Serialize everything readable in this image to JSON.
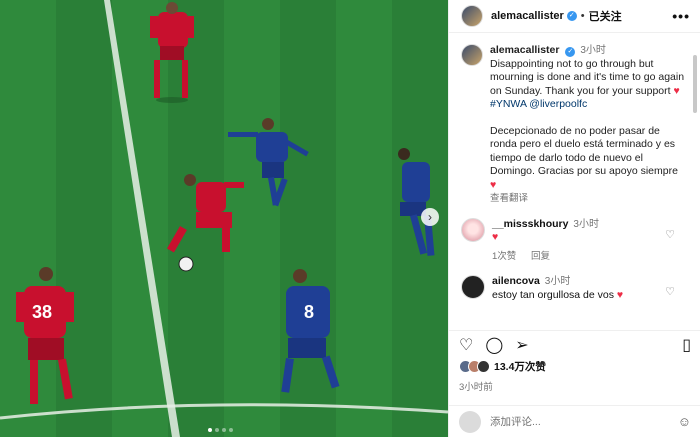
{
  "post": {
    "username": "alemacallister",
    "follow_state": "已关注",
    "more": "•••"
  },
  "caption": {
    "username": "alemacallister",
    "time": "3小时",
    "english": "Disappointing not to go through but mourning is done and it's time to go again on Sunday. Thank you for your support",
    "tags": "#YNWA @liverpoolfc",
    "spanish": "Decepcionado de no poder pasar de ronda pero el duelo está terminado y es tiempo de darlo todo de nuevo el Domingo. Gracias por su apoyo siempre",
    "see_translation": "查看翻译"
  },
  "comments": [
    {
      "username": "__missskhoury",
      "time": "3小时",
      "text": "♥",
      "likes": "1次赞",
      "reply": "回复"
    },
    {
      "username": "ailencova",
      "time": "3小时",
      "text": "estoy tan orgullosa de vos"
    }
  ],
  "actions": {
    "likes": "13.4万次赞",
    "posted": "3小时前"
  },
  "add_comment": {
    "placeholder": "添加评论..."
  },
  "icons": {
    "like": "heart-outline-icon",
    "comment": "comment-icon",
    "share": "share-icon",
    "save": "bookmark-icon",
    "emoji": "emoji-icon",
    "next": "chevron-right-icon"
  },
  "colors": {
    "accent": "#3797f0",
    "heart": "#ed2d46",
    "link": "#00376b"
  }
}
